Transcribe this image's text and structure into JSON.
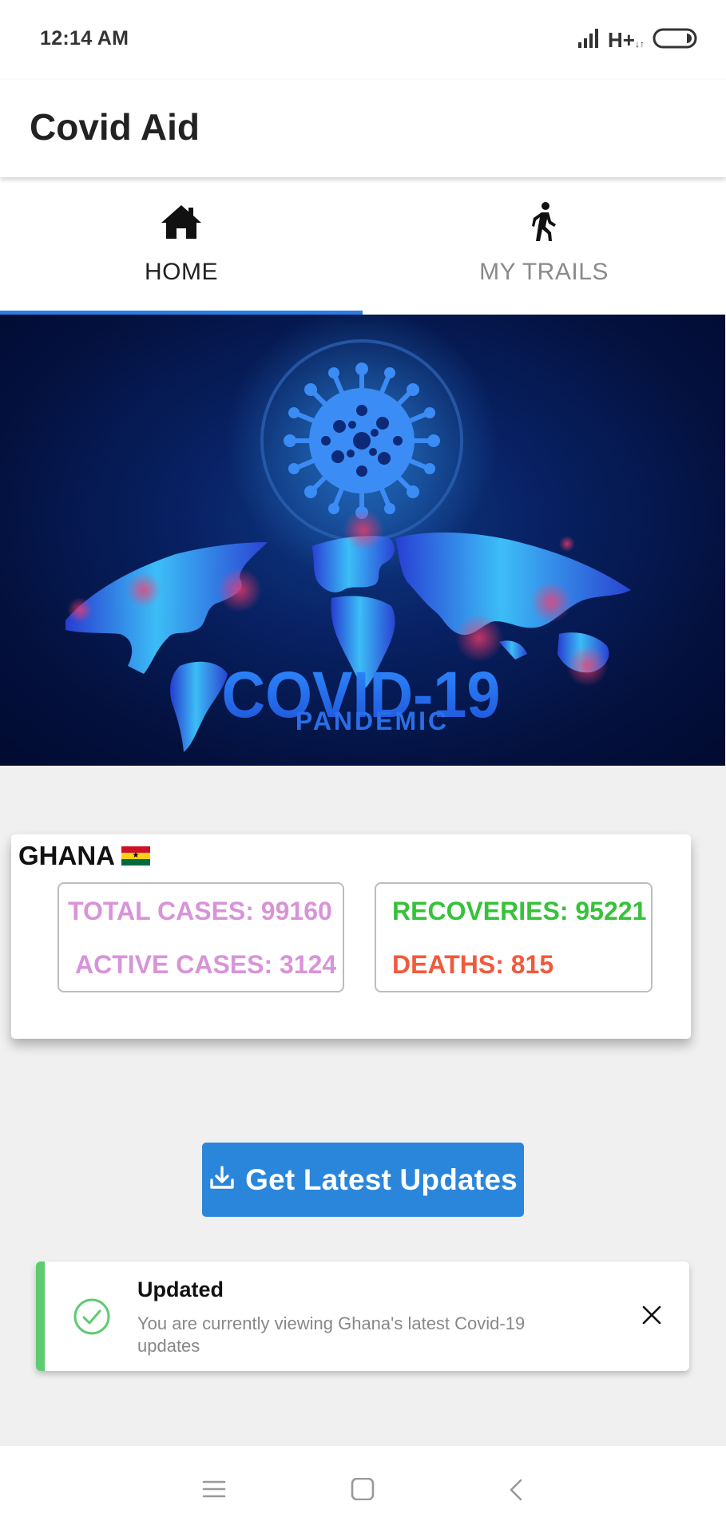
{
  "status_bar": {
    "time": "12:14 AM",
    "network": "H+",
    "icons": [
      "signal-icon",
      "network-type-icon",
      "battery-icon"
    ]
  },
  "app": {
    "title": "Covid Aid"
  },
  "tabs": [
    {
      "label": "HOME",
      "icon": "home-icon",
      "active": true
    },
    {
      "label": "MY TRAILS",
      "icon": "walking-person-icon",
      "active": false
    }
  ],
  "banner": {
    "title": "COVID-19",
    "subtitle": "PANDEMIC",
    "icons": [
      "virus-icon",
      "world-map-icon"
    ]
  },
  "stats": {
    "country": "GHANA",
    "flag_icon": "ghana-flag-icon",
    "total_cases": "TOTAL CASES: 99160",
    "active_cases": "ACTIVE CASES: 3124",
    "recoveries": "RECOVERIES: 95221",
    "deaths": "DEATHS: 815",
    "colors": {
      "cases": "#d894d8",
      "recoveries": "#36c23a",
      "deaths": "#f05a3c"
    }
  },
  "update_button": {
    "label": "Get Latest Updates",
    "icon": "download-icon",
    "color": "#2a86db"
  },
  "toast": {
    "title": "Updated",
    "message": "You are currently viewing Ghana's latest Covid-19 updates",
    "icon": "check-circle-icon",
    "close_icon": "close-icon",
    "accent_color": "#5ecb70"
  },
  "nav_bar": {
    "buttons": [
      "menu-icon",
      "home-square-icon",
      "back-chevron-icon"
    ]
  }
}
